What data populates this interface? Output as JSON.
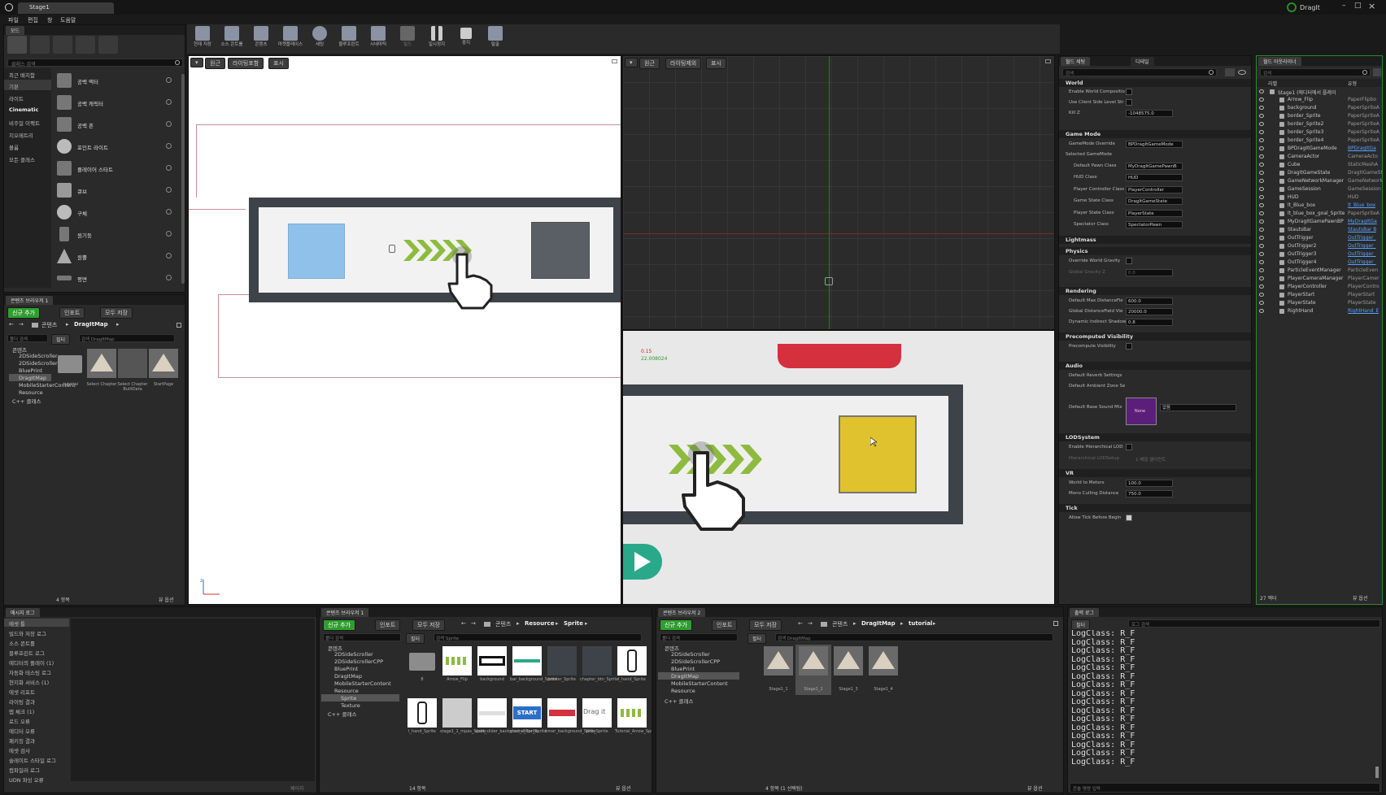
{
  "window": {
    "title": "Stage1",
    "brand": "DragIt",
    "win_min": "–",
    "win_max": "□",
    "win_close": "×"
  },
  "menu": [
    "파일",
    "편집",
    "창",
    "도움말"
  ],
  "modes": {
    "tab": "모드",
    "search_placeholder": "클래스 검색",
    "categories": [
      "최근 배치함",
      "기본",
      "라이트",
      "Cinematic",
      "비주얼 이펙트",
      "지오메트리",
      "볼륨",
      "모든 클래스"
    ],
    "items": [
      "공백 액터",
      "공백 캐릭터",
      "공백 폰",
      "포인트 라이트",
      "플레이어 스타트",
      "큐브",
      "구체",
      "원기둥",
      "원뿔",
      "평면"
    ]
  },
  "toolbar": [
    {
      "label": "현재 저장",
      "icon": "save-icon"
    },
    {
      "label": "소스 콘트롤",
      "icon": "source-control-icon"
    },
    {
      "label": "콘텐츠",
      "icon": "content-icon"
    },
    {
      "label": "마켓플레이스",
      "icon": "marketplace-icon"
    },
    {
      "label": "세팅",
      "icon": "settings-icon"
    },
    {
      "label": "블루프린트",
      "icon": "blueprint-icon"
    },
    {
      "label": "시네마틱",
      "icon": "cinematics-icon"
    },
    {
      "label": "빌드",
      "icon": "build-icon"
    },
    {
      "label": "일시정지",
      "icon": "pause-icon"
    },
    {
      "label": "중지",
      "icon": "stop-icon"
    },
    {
      "label": "탈출",
      "icon": "eject-icon"
    }
  ],
  "viewport_left": {
    "tabs": [
      "▾",
      "원근",
      "라이팅포함",
      "표시"
    ],
    "axis_label": "z"
  },
  "viewport_right": {
    "tabs": [
      "▾",
      "원근",
      "라이팅제외",
      "표시"
    ],
    "debug_line1": "0.15",
    "debug_line2": "22.008024"
  },
  "content_browser1": {
    "tab": "콘텐츠 브라우저 1",
    "add_new": "신규 추가",
    "import": "인포트",
    "save_all": "모두 저장",
    "path": [
      "콘텐츠",
      "DragItMap"
    ],
    "filters": "필터",
    "search_placeholder": "검색 DragItMap",
    "folder_search": "폴더 검색",
    "tree": [
      "콘텐츠",
      "2DSideScroller",
      "2DSideScrollerCPP",
      "BluePrint",
      "DragItMap",
      "MobileStarterContent",
      "Resource",
      "C++ 클래스"
    ],
    "assets": [
      "tutorial",
      "Select Chapter",
      "Select Chapter BuiltData",
      "StartPage"
    ],
    "count": "4 항목",
    "view_options": "뷰 옵션"
  },
  "world_settings": {
    "tabs": [
      "월드 세팅",
      "디테일"
    ],
    "search_placeholder": "검색",
    "sections": {
      "world": "World",
      "gamemode": "Game Mode",
      "lightmass": "Lightmass",
      "physics": "Physics",
      "rendering": "Rendering",
      "precomputed": "Precomputed Visibility",
      "audio": "Audio",
      "lod": "LODSystem",
      "vr": "VR",
      "tick": "Tick"
    },
    "rows": {
      "enable_world_composition": "Enable World Compositio",
      "use_client_side": "Use Client Side Level Str",
      "kill_z": "Kill Z",
      "kill_z_val": "-1048575.0",
      "gamemode_override": "GameMode Override",
      "gamemode_override_val": "BPDragItGameMode",
      "selected_gamemode": "Selected GameMode",
      "default_pawn": "Default Pawn Class",
      "default_pawn_val": "MyDragItGamePawnB",
      "hud": "HUD Class",
      "hud_val": "HUD",
      "player_controller": "Player Controller Class",
      "player_controller_val": "PlayerController",
      "game_state": "Game State Class",
      "game_state_val": "DragItGameState",
      "player_state": "Player State Class",
      "player_state_val": "PlayerState",
      "spectator": "Spectator Class",
      "spectator_val": "SpectatorPawn",
      "override_gravity": "Override World Gravity",
      "global_gravity": "Global Gravity Z",
      "global_gravity_val": "0.0",
      "max_distance": "Default Max DistanceFie",
      "max_distance_val": "600.0",
      "global_distance": "Global DistanceField Vie",
      "global_distance_val": "20000.0",
      "dynamic_indirect": "Dynamic Indirect Shadow",
      "dynamic_indirect_val": "0.8",
      "precompute_vis": "Precompute Visibility",
      "reverb": "Default Reverb Settings",
      "ambient": "Default Ambient Zone Se",
      "base_sound": "Default Base Sound Mix",
      "base_sound_none": "None",
      "base_sound_dropdown": "없음",
      "hlod": "Enable Hierarchical LOD",
      "hlod_setup": "Hierarchical LODSetup",
      "hlod_setup_val": "1 배열 엘리먼트",
      "world_to_meters": "World to Meters",
      "world_to_meters_val": "100.0",
      "mono_culling": "Mono Culling Distance",
      "mono_culling_val": "750.0",
      "allow_tick": "Allow Tick Before Begin"
    }
  },
  "outliner": {
    "tab": "월드 아웃라이너",
    "search_placeholder": "검색",
    "col_label": "라벨",
    "col_type": "유형",
    "items": [
      [
        "Stage1 (에디터에서 플레이)",
        "",
        0
      ],
      [
        "Arrow_Flip",
        "PaperFlipbo",
        1
      ],
      [
        "background",
        "PaperSpriteA",
        1
      ],
      [
        "border_Sprite",
        "PaperSpriteA",
        1
      ],
      [
        "border_Sprite2",
        "PaperSpriteA",
        1
      ],
      [
        "border_Sprite3",
        "PaperSpriteA",
        1
      ],
      [
        "border_Sprite4",
        "PaperSpriteA",
        1
      ],
      [
        "BPDragItGameMode",
        "BPDragItGa",
        2
      ],
      [
        "CameraActor",
        "CameraActo",
        1
      ],
      [
        "Cube",
        "StaticMeshA",
        1
      ],
      [
        "DragItGameState",
        "DragItGameSt",
        1
      ],
      [
        "GameNetworkManager",
        "GameNetwork",
        1
      ],
      [
        "GameSession",
        "GameSession",
        1
      ],
      [
        "HUD",
        "HUD",
        1
      ],
      [
        "lt_Blue_box",
        "lt_Blue_box",
        2
      ],
      [
        "lt_blue_box_goal_Sprite",
        "PaperSpriteA",
        1
      ],
      [
        "MyDragItGamePawnBP",
        "MyDragItGa",
        2
      ],
      [
        "StautsBar",
        "StautsBar B",
        2
      ],
      [
        "OutTrigger",
        "OutTrigger_",
        2
      ],
      [
        "OutTrigger2",
        "OutTrigger_",
        2
      ],
      [
        "OutTrigger3",
        "OutTrigger_",
        2
      ],
      [
        "OutTrigger4",
        "OutTrigger_",
        2
      ],
      [
        "ParticleEventManager",
        "ParticleEven",
        1
      ],
      [
        "PlayerCameraManager",
        "PlayerCamer",
        1
      ],
      [
        "PlayerController",
        "PlayerContro",
        1
      ],
      [
        "PlayerStart",
        "PlayerStart",
        1
      ],
      [
        "PlayerState",
        "PlayerState",
        1
      ],
      [
        "RightHand",
        "RightHand_E",
        2
      ]
    ],
    "count": "27 액터",
    "view_options": "뷰 옵션"
  },
  "message_log": {
    "tab": "메시지 로그",
    "categories": [
      "에셋 툴",
      "빌드와 저장 로그",
      "소스 콘트롤",
      "블루프린트 로그",
      "에디터의 플레이 (1)",
      "자동화 테스팅 로그",
      "현지화 서비스 (1)",
      "에셋 리포트",
      "라이팅 결과",
      "맵 체크 (1)",
      "로드 오류",
      "에디터 오류",
      "패키징 결과",
      "에셋 검사",
      "슬레이트 스타일 로그",
      "컴파일러 로그",
      "UDN 파싱 오류"
    ],
    "footer": "페이지"
  },
  "content_browser2": {
    "tab": "콘텐츠 브라우저 1",
    "add_new": "신규 추가",
    "import": "인포트",
    "save_all": "모두 저장",
    "path": [
      "콘텐츠",
      "Resource",
      "Sprite"
    ],
    "filters": "필터",
    "search_placeholder": "검색 Sprite",
    "folder_search": "폴더 검색",
    "tree": [
      "콘텐츠",
      "2DSideScroller",
      "2DSideScrollerCPP",
      "BluePrint",
      "DragItMap",
      "MobileStarterContent",
      "Resource",
      "Sprite",
      "Texture",
      "C++ 클래스"
    ],
    "assets_row1": [
      "8",
      "Arrow_Flip",
      "background",
      "bar_background_Sprite",
      "border_Sprite",
      "chapter_btn_Sprite",
      "l_hand_Sprite"
    ],
    "assets_row2": [
      "l_hand_Sprite",
      "stage1_1_mpas_Sprite",
      "start_slider_background_Sprite",
      "start_slider_Sprite",
      "timer_background_Sprite",
      "title_Sprite",
      "Tutorial_Arrow_Sprite"
    ],
    "start_text": "START",
    "dragit_text": "Drag it",
    "count": "14 항목",
    "view_options": "뷰 옵션"
  },
  "content_browser3": {
    "tab": "콘텐츠 브라우저 2",
    "add_new": "신규 추가",
    "import": "인포트",
    "save_all": "모두 저장",
    "path": [
      "콘텐츠",
      "DragItMap",
      "tutorial"
    ],
    "filters": "필터",
    "search_placeholder": "검색 DragItMap",
    "folder_search": "폴더 검색",
    "tree": [
      "콘텐츠",
      "2DSideScroller",
      "2DSideScrollerCPP",
      "BluePrint",
      "DragItMap",
      "MobileStarterContent",
      "Resource",
      "C++ 클래스"
    ],
    "assets": [
      "Stage1_1",
      "Stage1_2",
      "Stage1_3",
      "Stage1_4"
    ],
    "count": "4 항목 (1 선택됨)",
    "view_options": "뷰 옵션"
  },
  "output_log": {
    "tab": "출력 로그",
    "filters": "필터",
    "search_placeholder": "로그 검색",
    "lines": [
      "LogClass: R_F",
      "LogClass: R_F",
      "LogClass: R_F",
      "LogClass: R_F",
      "LogClass: R_F",
      "LogClass: R_F",
      "LogClass: R_F",
      "LogClass: R_F",
      "LogClass: R_F",
      "LogClass: R_F",
      "LogClass: R_F",
      "LogClass: R_F",
      "LogClass: R_F",
      "LogClass: R_F",
      "LogClass: R_F",
      "LogClass: R_F"
    ],
    "cmd_placeholder": "콘솔 명령 입력"
  }
}
